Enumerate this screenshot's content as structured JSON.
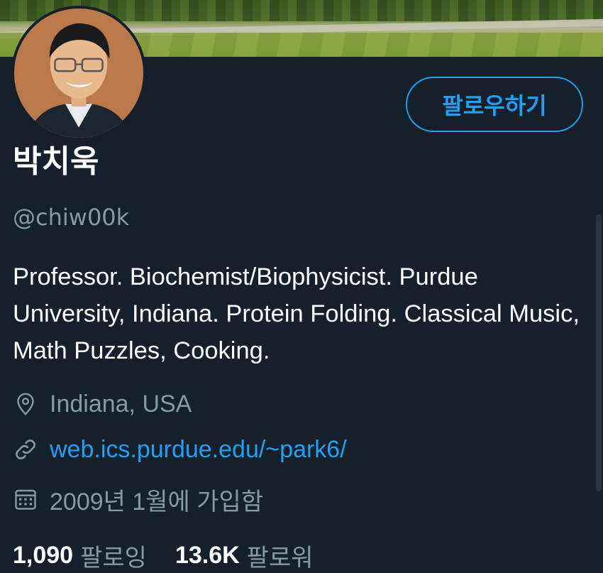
{
  "profile": {
    "name": "박치욱",
    "handle": "@chiw00k",
    "bio": "Professor. Biochemist/Biophysicist. Purdue University, Indiana. Protein Folding. Classical Music, Math Puzzles, Cooking.",
    "location": "Indiana, USA",
    "website": "web.ics.purdue.edu/~park6/",
    "joined": "2009년 1월에 가입함"
  },
  "actions": {
    "follow_label": "팔로우하기"
  },
  "stats": {
    "following_count": "1,090",
    "following_label": "팔로잉",
    "followers_count": "13.6K",
    "followers_label": "팔로워"
  },
  "icons": {
    "location": "location-pin-icon",
    "link": "link-icon",
    "calendar": "calendar-icon"
  },
  "colors": {
    "background": "#15202b",
    "accent": "#1da1f2",
    "secondary_text": "#8899a6"
  }
}
